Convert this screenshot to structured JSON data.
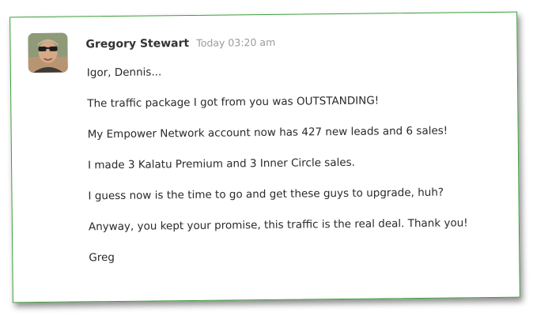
{
  "message": {
    "author": "Gregory Stewart",
    "timestamp": "Today 03:20 am",
    "avatar_icon": "user-photo",
    "border_color": "#3aa03a",
    "lines": [
      "Igor, Dennis...",
      "The traffic package I got from you was OUTSTANDING!",
      "My Empower Network account now has 427 new leads and 6 sales!",
      "I made 3 Kalatu Premium and 3 Inner Circle sales.",
      "I guess now is the time to go and get these guys to upgrade, huh?",
      "Anyway, you kept your promise, this traffic is the real deal. Thank you!",
      "Greg"
    ]
  }
}
